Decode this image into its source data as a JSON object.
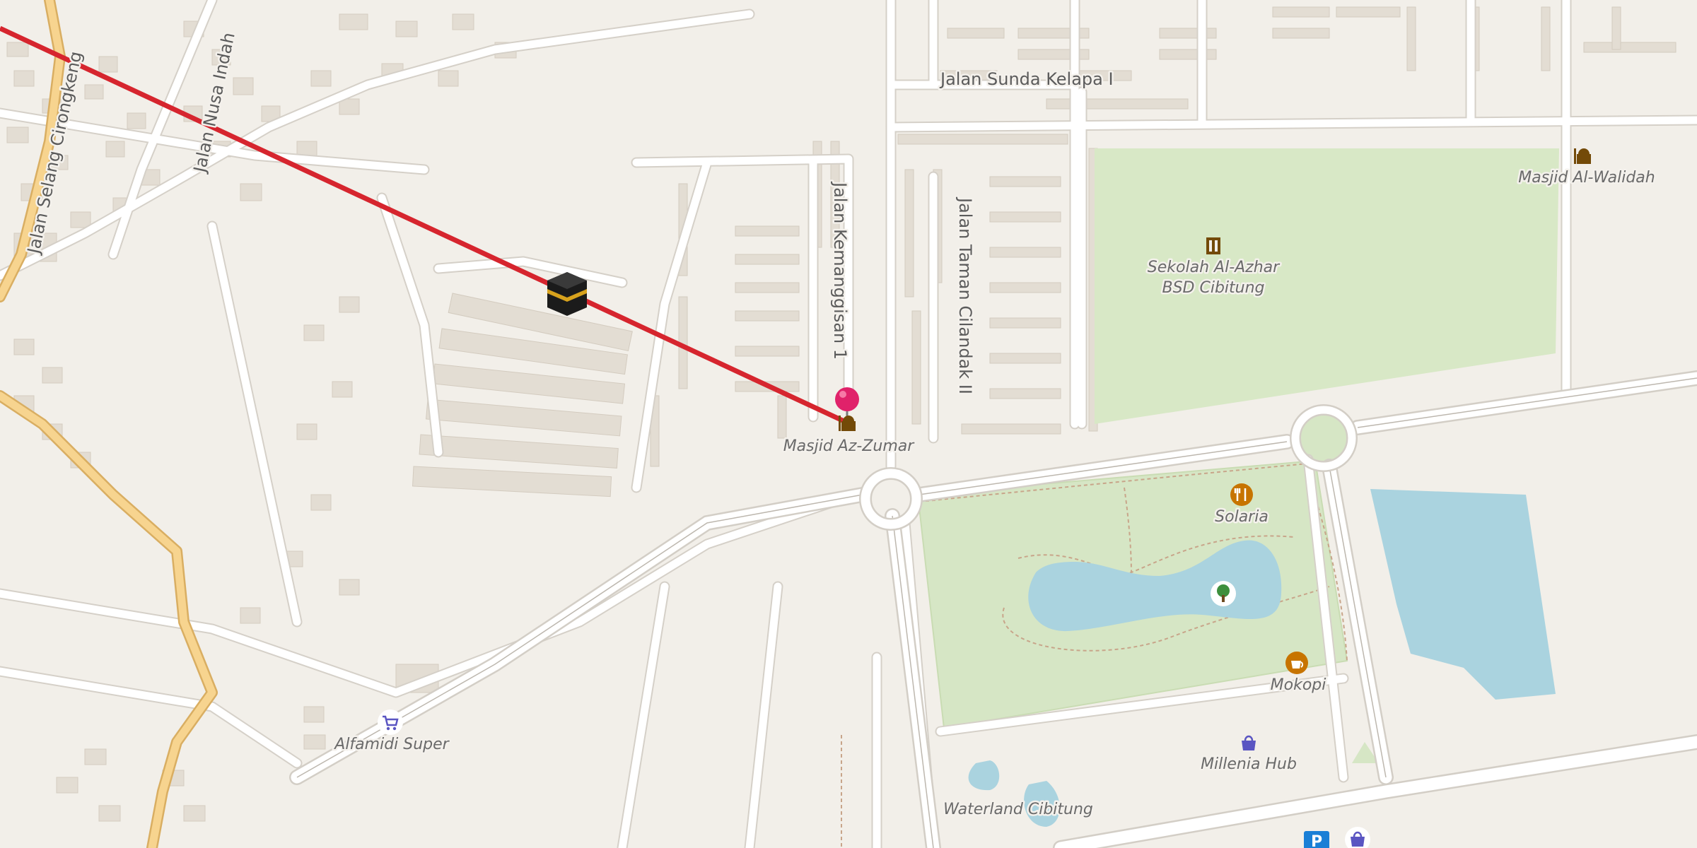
{
  "map": {
    "style": "OpenStreetMap Carto",
    "colors": {
      "background": "#f2efe9",
      "road": "#ffffff",
      "road_casing": "#d6d2cb",
      "major_road": "#f7d48f",
      "major_road_casing": "#d9ae62",
      "park": "#d8e8c6",
      "water": "#aad3df",
      "building": "#e1dad0",
      "qibla_line": "#d6252e",
      "marker": "#e0226a"
    },
    "streets": [
      "Jalan Sunda Kelapa I",
      "Jalan Nusa Indah",
      "Jalan Selang Cirongkeng",
      "Jalan Kemanggisan 1",
      "Jalan Taman Cilandak II"
    ],
    "pois": [
      {
        "label": "Masjid Az-Zumar",
        "icon": "mosque-icon"
      },
      {
        "label": "Masjid Al-Walidah",
        "icon": "mosque-icon"
      },
      {
        "label": "Sekolah Al-Azhar",
        "icon": "school-icon"
      },
      {
        "label": "BSD Cibitung"
      },
      {
        "label": "Solaria",
        "icon": "restaurant-icon"
      },
      {
        "label": "Mokopi",
        "icon": "cafe-icon"
      },
      {
        "label": "Millenia Hub",
        "icon": "shopping-bag-icon"
      },
      {
        "label": "Alfamidi Super",
        "icon": "shopping-cart-icon"
      },
      {
        "label": "Waterland Cibitung"
      },
      {
        "label": "",
        "icon": "park-tree-icon"
      },
      {
        "label": "P",
        "icon": "parking-icon"
      }
    ],
    "overlay": {
      "qibla_line": "qibla-direction-line",
      "kaaba_icon": "kaaba-icon",
      "location_marker": "location-pin-icon"
    }
  }
}
